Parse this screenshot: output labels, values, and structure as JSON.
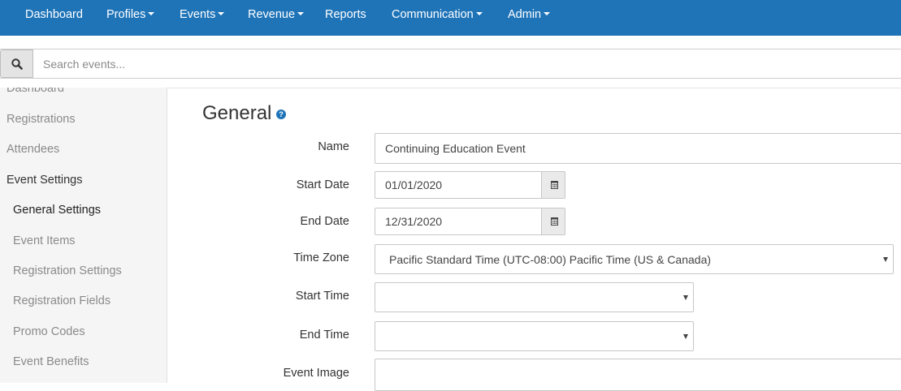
{
  "navbar": {
    "items": [
      {
        "label": "Dashboard",
        "dropdown": false
      },
      {
        "label": "Profiles",
        "dropdown": true
      },
      {
        "label": "Events",
        "dropdown": true
      },
      {
        "label": "Revenue",
        "dropdown": true
      },
      {
        "label": "Reports",
        "dropdown": false
      },
      {
        "label": "Communication",
        "dropdown": true
      },
      {
        "label": "Admin",
        "dropdown": true
      }
    ]
  },
  "search": {
    "placeholder": "Search events..."
  },
  "sidebar": {
    "items": [
      {
        "label": "Dashboard"
      },
      {
        "label": "Registrations"
      },
      {
        "label": "Attendees"
      },
      {
        "label": "Event Settings"
      },
      {
        "label": "General Settings"
      },
      {
        "label": "Event Items"
      },
      {
        "label": "Registration Settings"
      },
      {
        "label": "Registration Fields"
      },
      {
        "label": "Promo Codes"
      },
      {
        "label": "Event Benefits"
      }
    ]
  },
  "main": {
    "title": "General",
    "help_glyph": "?",
    "fields": {
      "name": {
        "label": "Name",
        "value": "Continuing Education Event"
      },
      "start_date": {
        "label": "Start Date",
        "value": "01/01/2020"
      },
      "end_date": {
        "label": "End Date",
        "value": "12/31/2020"
      },
      "time_zone": {
        "label": "Time Zone",
        "value": "Pacific Standard Time (UTC-08:00) Pacific Time (US & Canada)"
      },
      "start_time": {
        "label": "Start Time",
        "value": ""
      },
      "end_time": {
        "label": "End Time",
        "value": ""
      },
      "event_image": {
        "label": "Event Image",
        "value": ""
      }
    }
  },
  "colors": {
    "navbar": "#1f74b8",
    "sidebar_bg": "#f5f5f5",
    "accent": "#1f74b8"
  }
}
